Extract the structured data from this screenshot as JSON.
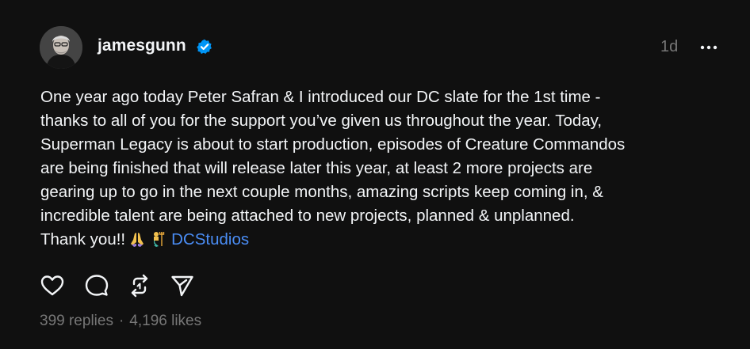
{
  "post": {
    "author": {
      "username": "jamesgunn",
      "verified": true,
      "avatar_icon": "profile-photo"
    },
    "timestamp": "1d",
    "more_icon": "more-horizontal-icon",
    "body_lines": [
      "One year ago today Peter Safran & I introduced our DC slate for the 1st time -",
      "thanks to all of you for the support you’ve given us throughout the year. Today,",
      "Superman Legacy is about to start production, episodes of Creature Commandos",
      "are being finished that will release later this year, at least 2 more projects are",
      "gearing up to go in the next couple months, amazing scripts keep coming in, &",
      "incredible talent are being attached to new projects, planned & unplanned."
    ],
    "closing_text": "Thank you!!",
    "emojis": [
      "🙏",
      "🧜‍♂️"
    ],
    "mention": "DCStudios",
    "actions": [
      {
        "name": "like",
        "icon": "heart-icon"
      },
      {
        "name": "reply",
        "icon": "comment-icon"
      },
      {
        "name": "repost",
        "icon": "repost-icon"
      },
      {
        "name": "share",
        "icon": "send-icon"
      }
    ],
    "stats": {
      "replies": "399 replies",
      "separator": "·",
      "likes": "4,196 likes"
    },
    "colors": {
      "background": "#101010",
      "text": "#f3f5f7",
      "muted": "#777777",
      "link": "#4a8df5",
      "verified": "#0095f6"
    }
  }
}
